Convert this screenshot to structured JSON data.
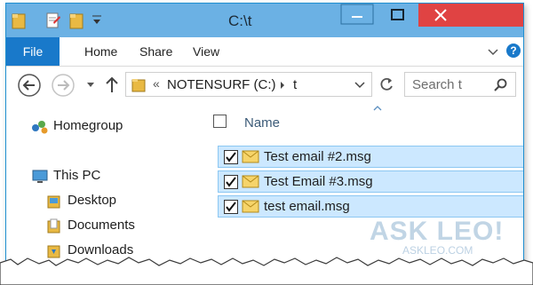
{
  "window": {
    "title": "C:\\t"
  },
  "ribbon": {
    "tabs": [
      "File",
      "Home",
      "Share",
      "View"
    ]
  },
  "address": {
    "separator": "«",
    "drive": "NOTENSURF (C:)",
    "folder": "t"
  },
  "search": {
    "placeholder": "Search t"
  },
  "nav": {
    "homegroup": "Homegroup",
    "this_pc": "This PC",
    "desktop": "Desktop",
    "documents": "Documents",
    "downloads": "Downloads"
  },
  "files": {
    "column_name": "Name",
    "items": [
      {
        "name": "Test email #2.msg",
        "checked": true
      },
      {
        "name": "Test Email #3.msg",
        "checked": true
      },
      {
        "name": "test email.msg",
        "checked": true
      }
    ]
  },
  "watermark": {
    "main": "ASK LEO!",
    "sub": "ASKLEO.COM"
  },
  "colors": {
    "titlebar": "#6bb1e4",
    "file_tab": "#1979ca",
    "close_button": "#e04343",
    "selection": "#cce8ff",
    "selection_border": "#8cc7f2"
  }
}
